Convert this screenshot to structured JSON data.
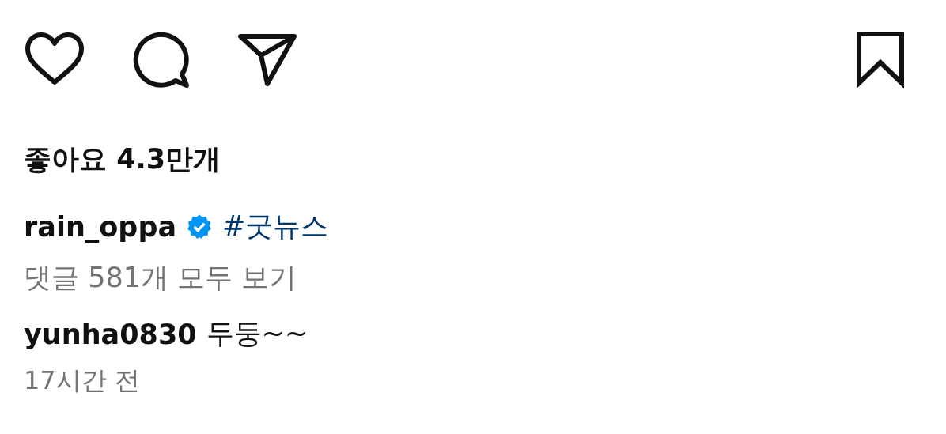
{
  "actions": {
    "liked": false,
    "saved": false
  },
  "likes": "좋아요 4.3만개",
  "caption": {
    "username": "rain_oppa",
    "verified": true,
    "hashtag": "#굿뉴스"
  },
  "view_comments": "댓글 581개 모두 보기",
  "comments": [
    {
      "username": "yunha0830",
      "text": "두둥~~"
    }
  ],
  "time": "17시간 전"
}
